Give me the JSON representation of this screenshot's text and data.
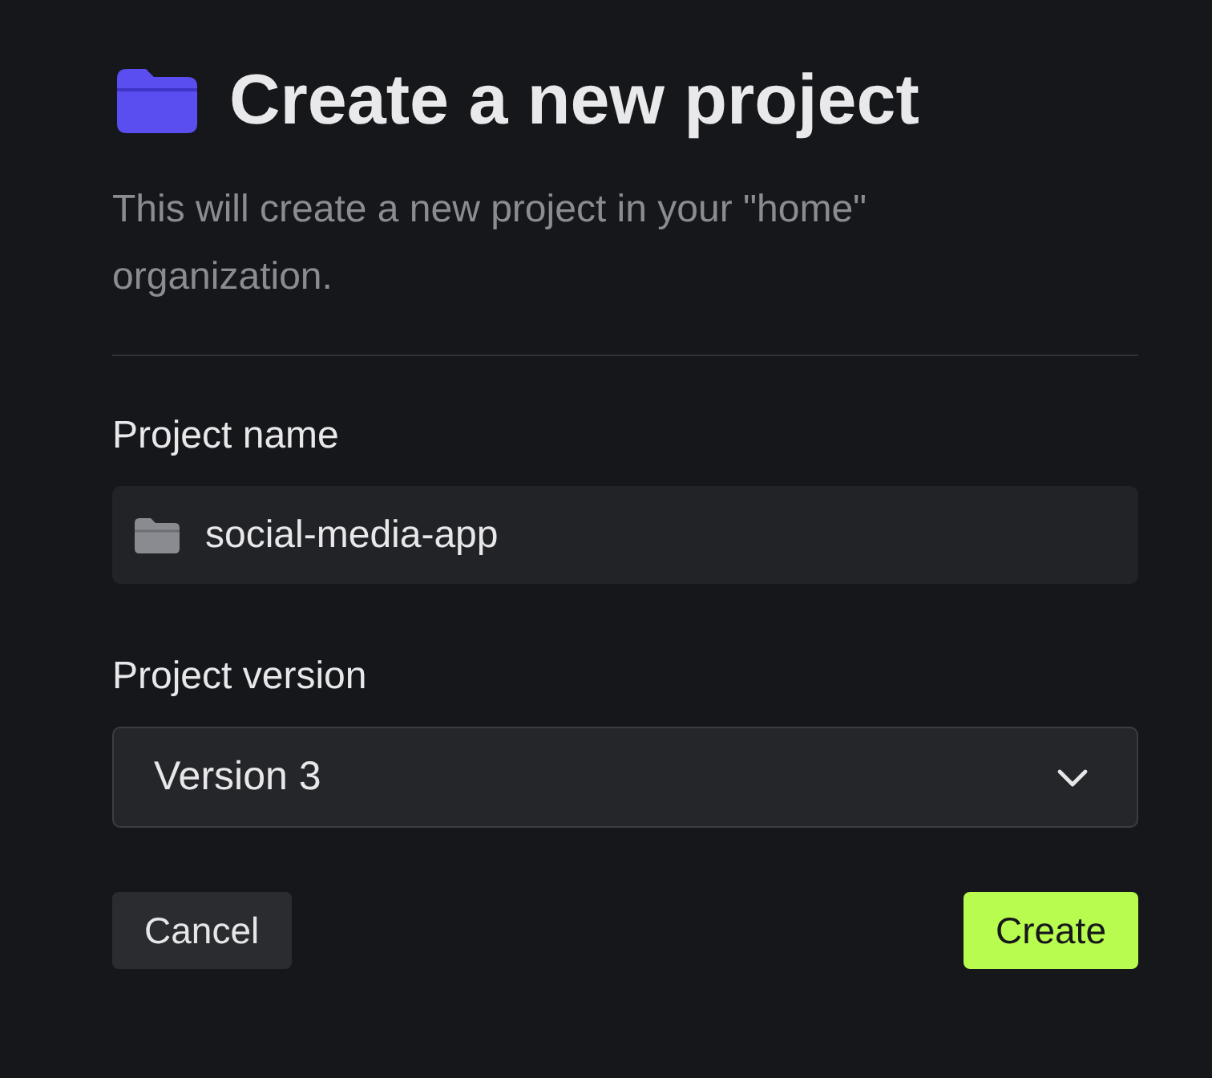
{
  "title": "Create a new project",
  "description": "This will create a new project in your \"home\" organization.",
  "fields": [
    {
      "kind": "text",
      "label": "Project name",
      "value": "social-media-app"
    },
    {
      "kind": "select",
      "label": "Project version",
      "value": "Version 3"
    }
  ],
  "buttons": [
    {
      "kind": "secondary",
      "label": "Cancel"
    },
    {
      "kind": "primary",
      "label": "Create"
    }
  ]
}
